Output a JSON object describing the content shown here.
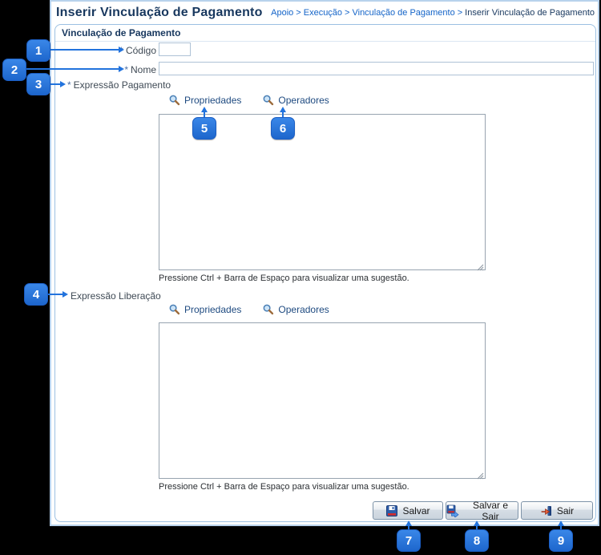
{
  "header": {
    "title": "Inserir Vinculação de Pagamento",
    "breadcrumb": {
      "segments": [
        "Apoio",
        "Execução",
        "Vinculação de Pagamento"
      ],
      "separator": ">",
      "current": "Inserir Vinculação de Pagamento"
    }
  },
  "form": {
    "section_title": "Vinculação de Pagamento",
    "required_marker": "*",
    "codigo": {
      "label": "Código",
      "value": ""
    },
    "nome": {
      "label": "Nome",
      "value": ""
    },
    "expressao_pagamento": {
      "label": "Expressão Pagamento",
      "value": ""
    },
    "expressao_liberacao": {
      "label": "Expressão Liberação",
      "value": ""
    },
    "propriedades_link": "Propriedades",
    "operadores_link": "Operadores",
    "suggestion_hint": "Pressione Ctrl + Barra de Espaço para visualizar uma sugestão.",
    "buttons": {
      "salvar": "Salvar",
      "salvar_e_sair": "Salvar e Sair",
      "sair": "Sair"
    }
  },
  "icons": {
    "lookup": "magnifier-icon",
    "salvar": "floppy-disk-icon",
    "salvar_e_sair": "floppy-disk-arrow-icon",
    "sair": "door-exit-icon"
  },
  "annotations": {
    "badges": [
      "1",
      "2",
      "3",
      "4",
      "5",
      "6",
      "7",
      "8",
      "9"
    ],
    "badge_color": "#2273dd",
    "arrow_color": "#2273dd"
  },
  "colors": {
    "background": "#000000",
    "panel": "#ffffff",
    "title_navy": "#17375e",
    "breadcrumb_blue": "#1464c8",
    "section_border": "#9cc0e2",
    "link_navy": "#1e4a80"
  }
}
